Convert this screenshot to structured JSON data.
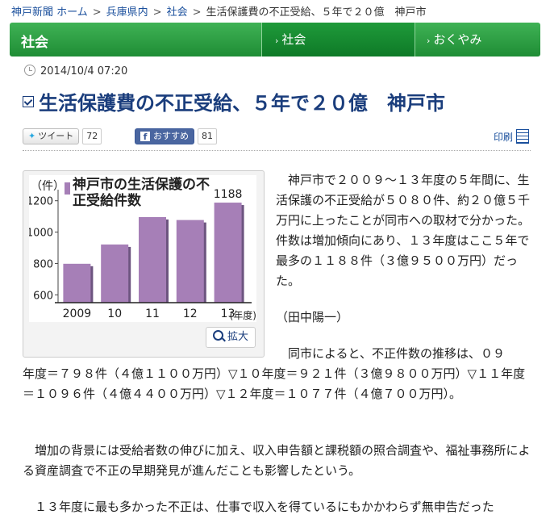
{
  "breadcrumb": {
    "items": [
      "神戸新聞 ホーム",
      "兵庫県内",
      "社会"
    ],
    "current": "生活保護費の不正受給、５年で２０億　神戸市",
    "separator": ">"
  },
  "category_bar": {
    "title": "社会",
    "tabs": [
      {
        "label": "社会"
      },
      {
        "label": "おくやみ"
      }
    ]
  },
  "article": {
    "datetime": "2014/10/4 07:20",
    "headline": "生活保護費の不正受給、５年で２０億　神戸市",
    "paragraphs": [
      "　神戸市で２００９～１３年度の５年間に、生活保護の不正受給が５０８０件、約２０億５千万円に上ったことが同市への取材で分かった。件数は増加傾向にあり、１３年度はここ５年で最多の１１８８件（３億９５００万円）だった。",
      "（田中陽一）",
      "　同市によると、不正件数の推移は、０９",
      "年度＝７９８件（４億１１００万円）▽１０年度＝９２１件（３億９８００万円）▽１１年度＝１０９６件（４億４４００万円）▽１２年度＝１０７７件（４億７００万円）。",
      "　増加の背景には受給者数の伸びに加え、収入申告額と課税額の照合調査や、福祉事務所による資産調査で不正の早期発見が進んだことも影響したという。",
      "　１３年度に最も多かった不正は、仕事で収入を得ているにもかかわらず無申告だった"
    ]
  },
  "social": {
    "tweet_label": "ツイート",
    "tweet_count": "72",
    "fb_label": "おすすめ",
    "fb_count": "81",
    "print_label": "印刷"
  },
  "figure": {
    "zoom_label": "拡大"
  },
  "chart_data": {
    "type": "bar",
    "title": "神戸市の生活保護の不正受給件数",
    "yunit": "（件）",
    "xunit": "(年度)",
    "categories": [
      "2009",
      "10",
      "11",
      "12",
      "13"
    ],
    "values": [
      798,
      921,
      1096,
      1077,
      1188
    ],
    "labeled_value": "1188",
    "yticks": [
      600,
      800,
      1000,
      1200
    ],
    "ylim": [
      550,
      1250
    ],
    "bar_color": "#a67fb7",
    "grid": false
  },
  "colors": {
    "green": "#2ea046",
    "headline": "#1a3d7c",
    "link": "#1a4f9c"
  }
}
